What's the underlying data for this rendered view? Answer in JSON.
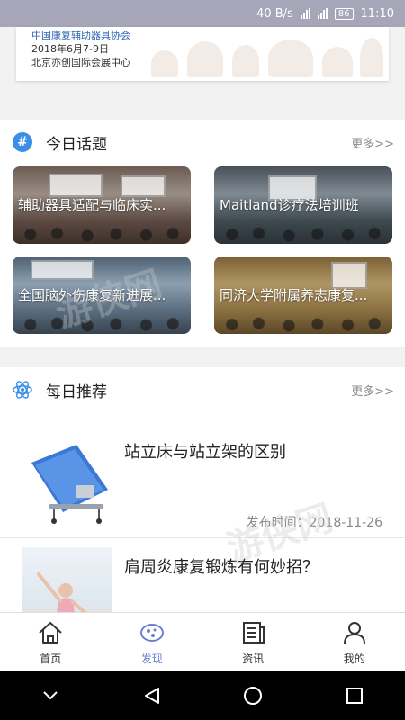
{
  "status_bar": {
    "speed": "40 B/s",
    "battery": "86",
    "time": "11:10"
  },
  "banner": {
    "org": "中国康复辅助器具协会",
    "date": "2018年6月7-9日",
    "venue": "北京亦创国际会展中心"
  },
  "topics": {
    "title": "今日话题",
    "more": "更多>>",
    "icon": "hash-icon",
    "items": [
      {
        "label": "辅助器具适配与临床实..."
      },
      {
        "label": "Maitland诊疗法培训班"
      },
      {
        "label": "全国脑外伤康复新进展..."
      },
      {
        "label": "同济大学附属养志康复..."
      }
    ]
  },
  "daily": {
    "title": "每日推荐",
    "more": "更多>>",
    "icon": "atom-icon",
    "articles": [
      {
        "title": "站立床与站立架的区别",
        "time": "发布时间：2018-11-26"
      },
      {
        "title": "肩周炎康复锻炼有何妙招？"
      }
    ]
  },
  "nav": {
    "items": [
      {
        "label": "首页",
        "icon": "home-icon"
      },
      {
        "label": "发现",
        "icon": "discover-icon",
        "active": true
      },
      {
        "label": "资讯",
        "icon": "news-icon"
      },
      {
        "label": "我的",
        "icon": "profile-icon"
      }
    ],
    "active_color": "#6a7fd0"
  },
  "colors": {
    "accent": "#3a8ee6",
    "status_bar": "#a6a6b8"
  }
}
